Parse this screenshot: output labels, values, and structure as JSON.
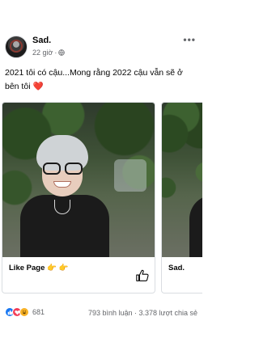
{
  "post": {
    "author": "Sad.",
    "time": "22 giờ",
    "separator": "·",
    "more_label": "•••",
    "caption": "2021 tôi có cậu...Mong rằng 2022 cậu vẫn sẽ ở bên tôi",
    "caption_emoji": "❤️"
  },
  "carousel": {
    "cards": [
      {
        "title": "Like Page 👉 👉",
        "icon": "thumbs-up-icon"
      },
      {
        "title": "Sad.",
        "icon": "thumbs-up-icon"
      }
    ]
  },
  "stats": {
    "reaction_icons": [
      "like-icon",
      "love-icon",
      "haha-icon"
    ],
    "reaction_count": "681",
    "comments": "793 bình luận",
    "dot": " · ",
    "shares": "3.378 lượt chia sẻ"
  },
  "colors": {
    "text": "#050505",
    "secondary": "#65676b",
    "like_blue": "#1877f2",
    "love_red": "#f33e58",
    "haha_yellow": "#f7b125",
    "border": "#dadde1"
  }
}
